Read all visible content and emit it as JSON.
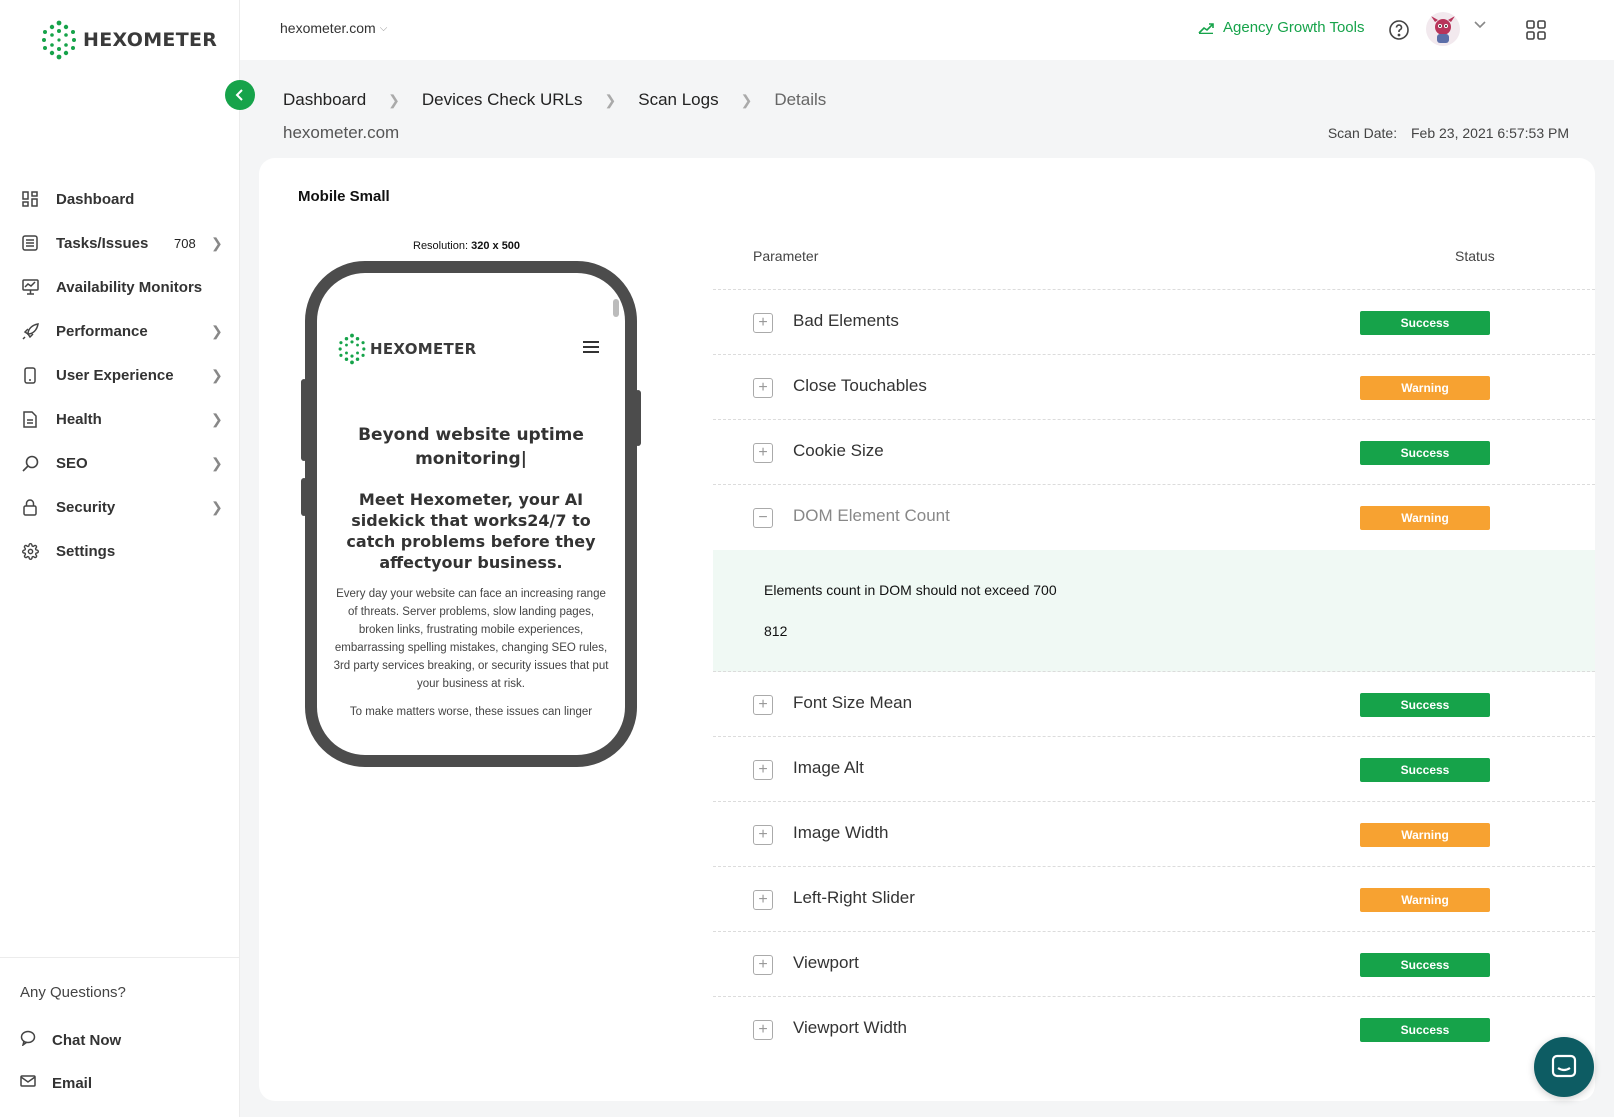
{
  "brand": {
    "name": "HEXOMETER",
    "accent": "#16a34a"
  },
  "sidebar": {
    "items": [
      {
        "label": "Dashboard",
        "icon": "dashboard-icon"
      },
      {
        "label": "Tasks/Issues",
        "icon": "list-icon",
        "count": "708"
      },
      {
        "label": "Availability Monitors",
        "icon": "monitor-icon"
      },
      {
        "label": "Performance",
        "icon": "rocket-icon"
      },
      {
        "label": "User Experience",
        "icon": "mobile-icon"
      },
      {
        "label": "Health",
        "icon": "document-icon"
      },
      {
        "label": "SEO",
        "icon": "search-icon"
      },
      {
        "label": "Security",
        "icon": "lock-icon"
      },
      {
        "label": "Settings",
        "icon": "gear-icon"
      }
    ],
    "any_questions": "Any Questions?",
    "chat_now": "Chat Now",
    "email": "Email"
  },
  "topbar": {
    "site": "hexometer.com",
    "agency_tools": "Agency Growth Tools"
  },
  "breadcrumb": {
    "items": [
      "Dashboard",
      "Devices Check URLs",
      "Scan Logs",
      "Details"
    ]
  },
  "page": {
    "site": "hexometer.com",
    "scan_date_label": "Scan Date:",
    "scan_date": "Feb 23, 2021 6:57:53 PM"
  },
  "card": {
    "title": "Mobile Small",
    "resolution_label": "Resolution:",
    "resolution": "320 x 500"
  },
  "phone_preview": {
    "logo": "HEXOMETER",
    "headline": "Beyond  website uptime monitoring|",
    "subheadline": "Meet Hexometer, your AI sidekick that works24/7 to catch problems before they affectyour business.",
    "body": "Every day your website can face an increasing range of threats. Server problems, slow landing pages, broken links, frustrating mobile experiences, embarrassing spelling mistakes, changing SEO rules, 3rd party services breaking, or security issues that put your business at risk.",
    "body2": "To make matters worse, these issues can linger"
  },
  "table": {
    "header_parameter": "Parameter",
    "header_status": "Status",
    "rows": [
      {
        "name": "Bad Elements",
        "status": "Success"
      },
      {
        "name": "Close Touchables",
        "status": "Warning"
      },
      {
        "name": "Cookie Size",
        "status": "Success"
      },
      {
        "name": "DOM Element Count",
        "status": "Warning",
        "expanded": true
      },
      {
        "name": "Font Size Mean",
        "status": "Success"
      },
      {
        "name": "Image Alt",
        "status": "Success"
      },
      {
        "name": "Image Width",
        "status": "Warning"
      },
      {
        "name": "Left-Right Slider",
        "status": "Warning"
      },
      {
        "name": "Viewport",
        "status": "Success"
      },
      {
        "name": "Viewport Width",
        "status": "Success"
      }
    ],
    "detail": {
      "message": "Elements count in DOM should not exceed 700",
      "value": "812"
    }
  },
  "colors": {
    "success": "#16a34a",
    "warning": "#f7a231",
    "chat_fab": "#0d5c63"
  }
}
